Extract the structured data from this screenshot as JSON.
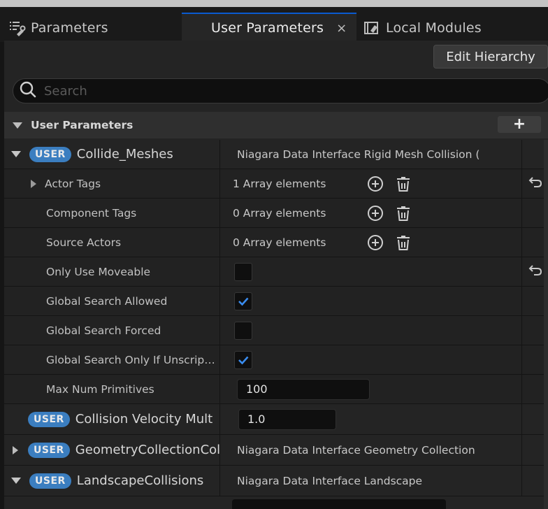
{
  "tabs": [
    {
      "label": "Parameters",
      "icon": "parameters-icon"
    },
    {
      "label": "User Parameters",
      "icon": "",
      "active": true,
      "close": "×"
    },
    {
      "label": "Local Modules",
      "icon": "local-modules-icon"
    }
  ],
  "toolbar": {
    "edit_hierarchy_label": "Edit Hierarchy"
  },
  "search": {
    "placeholder": "Search",
    "value": ""
  },
  "section": {
    "title": "User Parameters",
    "add_label": "+"
  },
  "badge_label": "USER",
  "params": {
    "collide_meshes": {
      "name": "Collide_Meshes",
      "type": "Niagara Data Interface Rigid Mesh Collision (",
      "expanded": true
    },
    "collision_velocity": {
      "name": "Collision Velocity Mult",
      "value": "1.0"
    },
    "geometry_collection": {
      "name": "GeometryCollectionCol",
      "type": "Niagara Data Interface Geometry Collection",
      "expanded": false
    },
    "landscape": {
      "name": "LandscapeCollisions",
      "type": "Niagara Data Interface Landscape",
      "expanded": true
    }
  },
  "children": {
    "actor_tags": {
      "label": "Actor Tags",
      "value": "1 Array elements"
    },
    "component_tags": {
      "label": "Component Tags",
      "value": "0 Array elements"
    },
    "source_actors": {
      "label": "Source Actors",
      "value": "0 Array elements"
    },
    "only_use_moveable": {
      "label": "Only Use Moveable",
      "checked": false
    },
    "global_search_allowed": {
      "label": "Global Search Allowed",
      "checked": true
    },
    "global_search_forced": {
      "label": "Global Search Forced",
      "checked": false
    },
    "global_search_only_if": {
      "label": "Global Search Only If Unscript...",
      "checked": true
    },
    "max_num_primitives": {
      "label": "Max Num Primitives",
      "value": "100"
    }
  },
  "colors": {
    "accent": "#0a5ad0",
    "badge": "#3b7ec0",
    "check": "#3a8df0"
  }
}
